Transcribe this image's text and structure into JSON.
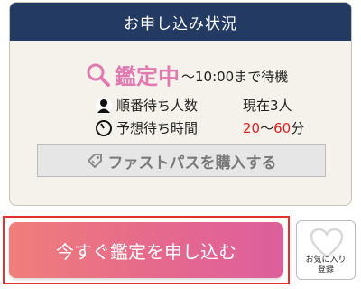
{
  "card": {
    "title": "お申し込み状況",
    "status_label": "鑑定中",
    "status_time": "〜10:00まで待機",
    "queue_label": "順番待ち人数",
    "queue_value": "現在3人",
    "wait_label": "予想待ち時間",
    "wait_min": "20",
    "wait_sep": "〜",
    "wait_max": "60",
    "wait_unit": "分",
    "fastpass_label": "ファストパスを購入する"
  },
  "apply_label": "今すぐ鑑定を申し込む",
  "favorite": {
    "line1": "お気に入り",
    "line2": "登録"
  },
  "colors": {
    "header_bg": "#233a63",
    "status_pink": "#e07ab1",
    "wait_red": "#e02020",
    "apply_gradient_start": "#f07e7a",
    "apply_gradient_end": "#dd5f9c",
    "highlight_outline": "#e03030"
  },
  "icons": [
    "search-icon",
    "person-icon",
    "clock-icon",
    "tag-icon",
    "heart-icon"
  ]
}
